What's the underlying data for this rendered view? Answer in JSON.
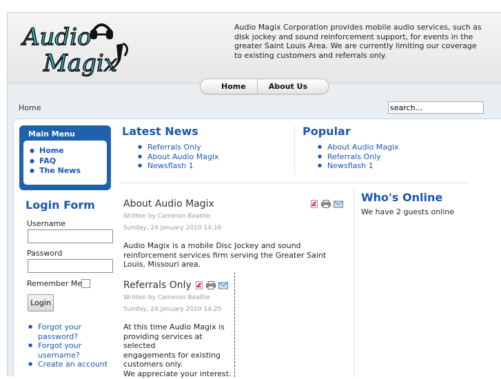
{
  "header": {
    "logo_text_line1": "Audio",
    "logo_text_line2": "Magix",
    "intro": "Audio Magix Corporation provides mobile audio services, such as disk jockey and sound reinforcement support, for events in the greater Saint Louis Area.  We are currently limiting our coverage to existing customers and referrals only."
  },
  "topnav": {
    "items": [
      "Home",
      "About Us"
    ]
  },
  "breadcrumb": "Home",
  "search": {
    "value": "search..."
  },
  "mainmenu": {
    "title": "Main Menu",
    "items": [
      "Home",
      "FAQ",
      "The News"
    ]
  },
  "login": {
    "title": "Login Form",
    "username_label": "Username",
    "password_label": "Password",
    "remember_label": "Remember Me",
    "button": "Login",
    "links": [
      "Forgot your password?",
      "Forgot your username?",
      "Create an account"
    ]
  },
  "latest_news": {
    "title": "Latest News",
    "items": [
      "Referrals Only",
      "About Audio Magix",
      "Newsflash 1"
    ]
  },
  "popular": {
    "title": "Popular",
    "items": [
      "About Audio Magix",
      "Referrals Only",
      "Newsflash 1"
    ]
  },
  "articles": [
    {
      "title": "About Audio Magix",
      "author": "Written by Cameron Beattie",
      "date": "Sunday, 24 January 2010 14:16",
      "body": "Audio Magix is a mobile Disc Jockey and sound reinforcement services firm serving the Greater Saint Louis, Missouri area."
    },
    {
      "title": "Referrals Only",
      "author": "Written by Cameron Beattie",
      "date": "Sunday, 24 January 2010 14:25",
      "body_lines": [
        "At this time Audio Magix is",
        "providing services at selected",
        "engagements for existing",
        "customers only.",
        "We appreciate your interest."
      ]
    }
  ],
  "whos_online": {
    "title": "Who's Online",
    "text": "We have 2 guests online"
  },
  "icons": [
    "pdf-icon",
    "print-icon",
    "email-icon"
  ],
  "colors": {
    "link": "#1b57b1",
    "menu_bg": "#1e62ad",
    "page_bg": "#e9eef3"
  }
}
